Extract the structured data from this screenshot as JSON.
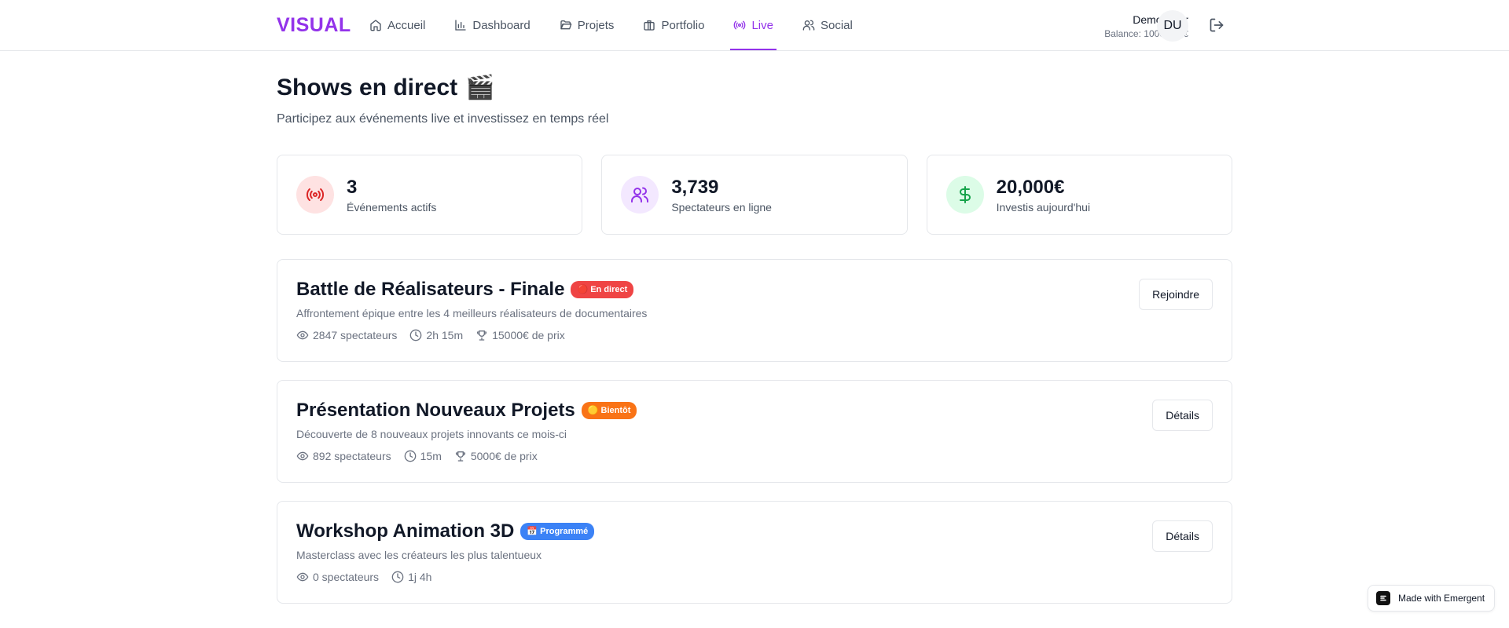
{
  "app": {
    "logo": "VISUAL"
  },
  "nav": [
    {
      "label": "Accueil",
      "icon": "home-icon"
    },
    {
      "label": "Dashboard",
      "icon": "bar-chart-icon"
    },
    {
      "label": "Projets",
      "icon": "folder-open-icon"
    },
    {
      "label": "Portfolio",
      "icon": "briefcase-icon"
    },
    {
      "label": "Live",
      "icon": "radio-icon",
      "active": true
    },
    {
      "label": "Social",
      "icon": "users-icon"
    }
  ],
  "user": {
    "name": "Demo User",
    "balance": "Balance: 10000.00€",
    "initials": "DU"
  },
  "page": {
    "title": "Shows en direct",
    "title_emoji": "🎬",
    "subtitle": "Participez aux événements live et investissez en temps réel"
  },
  "stats": [
    {
      "value": "3",
      "label": "Événements actifs",
      "icon": "radio-icon",
      "color": "#dc2626",
      "bg": "#fee2e2"
    },
    {
      "value": "3,739",
      "label": "Spectateurs en ligne",
      "icon": "users-icon",
      "color": "#9333ea",
      "bg": "#f3e8ff"
    },
    {
      "value": "20,000€",
      "label": "Investis aujourd'hui",
      "icon": "dollar-icon",
      "color": "#16a34a",
      "bg": "#dcfce7"
    }
  ],
  "events": [
    {
      "title": "Battle de Réalisateurs - Finale",
      "badge": "🔴 En direct",
      "badge_color": "#ef4444",
      "description": "Affrontement épique entre les 4 meilleurs réalisateurs de documentaires",
      "viewers": "2847 spectateurs",
      "duration": "2h 15m",
      "prize": "15000€ de prix",
      "action": "Rejoindre"
    },
    {
      "title": "Présentation Nouveaux Projets",
      "badge": "🟡 Bientôt",
      "badge_color": "#f97316",
      "description": "Découverte de 8 nouveaux projets innovants ce mois-ci",
      "viewers": "892 spectateurs",
      "duration": "15m",
      "prize": "5000€ de prix",
      "action": "Détails"
    },
    {
      "title": "Workshop Animation 3D",
      "badge": "📅 Programmé",
      "badge_color": "#3b82f6",
      "description": "Masterclass avec les créateurs les plus talentueux",
      "viewers": "0 spectateurs",
      "duration": "1j 4h",
      "prize": "",
      "action": "Détails"
    }
  ],
  "footer_badge": {
    "label": "Made with Emergent"
  }
}
